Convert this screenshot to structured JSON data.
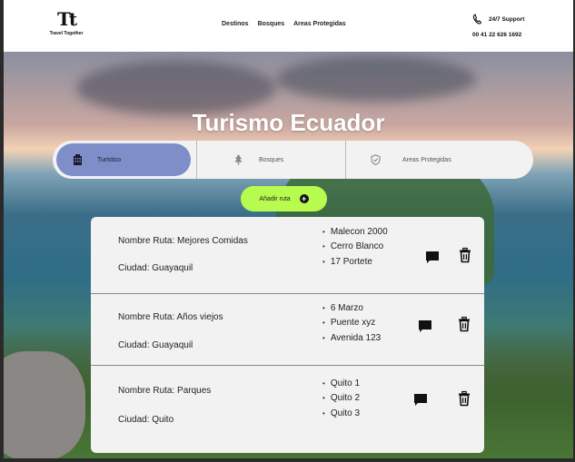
{
  "brand": {
    "mark": "Tt",
    "name": "Travel Together"
  },
  "nav": [
    "Destinos",
    "Bosques",
    "Areas Protegidas"
  ],
  "support": {
    "label": "24/7 Support",
    "phone": "00 41 22 626 1692"
  },
  "hero": {
    "title": "Turismo Ecuador"
  },
  "tabs": [
    {
      "label": "Turistico",
      "icon": "building-icon",
      "active": true
    },
    {
      "label": "Bosques",
      "icon": "tree-icon",
      "active": false
    },
    {
      "label": "Areas Protegidas",
      "icon": "shield-check-icon",
      "active": false
    }
  ],
  "add_button": {
    "label": "Añadir ruta"
  },
  "routes": [
    {
      "name": "Nombre Ruta: Mejores Comidas",
      "city": "Ciudad:  Guayaquil",
      "stops": [
        "Malecon 2000",
        "Cerro Blanco",
        "17 Portete"
      ]
    },
    {
      "name": "Nombre Ruta: Años viejos",
      "city": "Ciudad:  Guayaquil",
      "stops": [
        "6 Marzo",
        "Puente xyz",
        "Avenida 123"
      ]
    },
    {
      "name": "Nombre Ruta: Parques",
      "city": "Ciudad:  Quito",
      "stops": [
        "Quito 1",
        "Quito 2",
        "Quito 3"
      ]
    }
  ],
  "colors": {
    "active_tab": "#7f8dc9",
    "add_button": "#b7fb4e",
    "panel": "#f2f2f2"
  }
}
